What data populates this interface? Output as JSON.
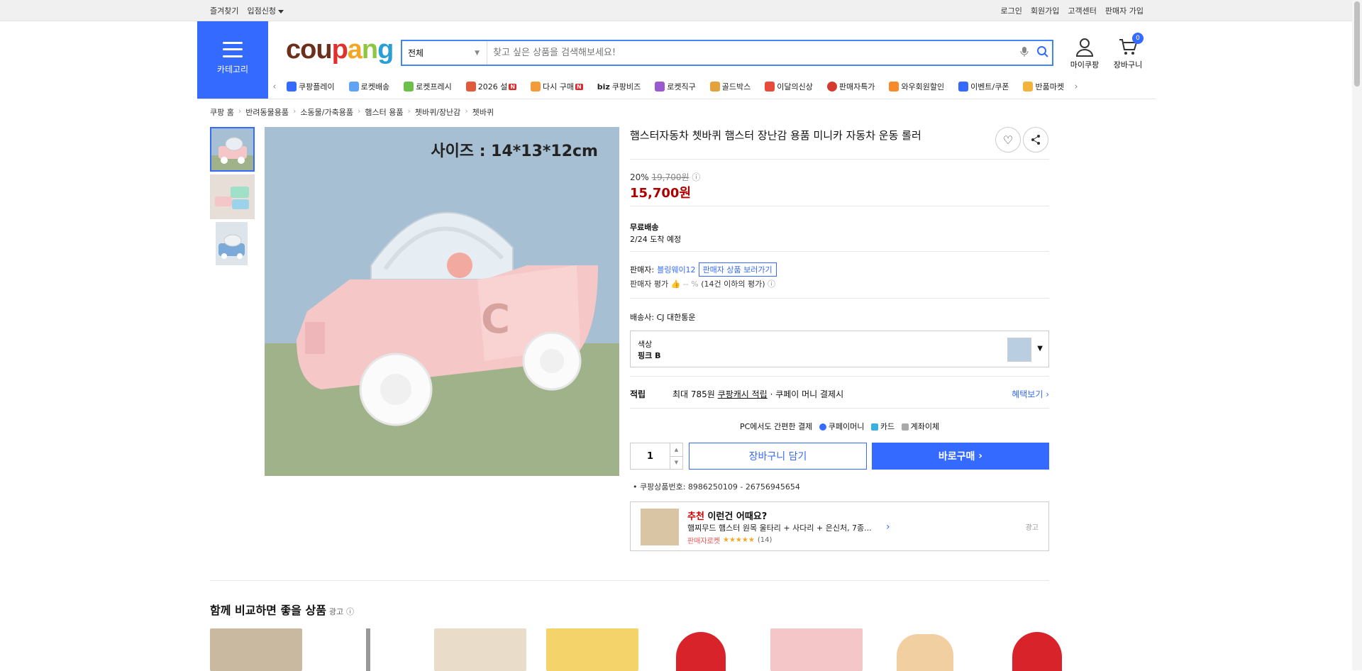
{
  "topbar": {
    "left": [
      "즐겨찾기",
      "입점신청"
    ],
    "right": [
      "로그인",
      "회원가입",
      "고객센터",
      "판매자 가입"
    ]
  },
  "header": {
    "category_label": "카테고리",
    "logo": {
      "c1": "cou",
      "c2": "p",
      "c3": "a",
      "c4": "n",
      "c5": "g"
    },
    "search_select": "전체",
    "search_placeholder": "찾고 싶은 상품을 검색해보세요!",
    "my_label": "마이쿠팡",
    "cart_label": "장바구니",
    "cart_count": "0"
  },
  "nav_items": [
    {
      "label": "쿠팡플레이",
      "color": "#346aff",
      "badge": ""
    },
    {
      "label": "로켓배송",
      "color": "#5fa3f5",
      "badge": ""
    },
    {
      "label": "로켓프레시",
      "color": "#6cc04a",
      "badge": ""
    },
    {
      "label": "2026 설",
      "color": "#e05a3b",
      "badge": "N"
    },
    {
      "label": "다시 구매",
      "color": "#f29b38",
      "badge": "N"
    },
    {
      "label": "쿠팡비즈",
      "color": "#333333",
      "badge": "",
      "prefix": "biz"
    },
    {
      "label": "로켓직구",
      "color": "#9b59d0",
      "badge": ""
    },
    {
      "label": "골드박스",
      "color": "#e3a23a",
      "badge": ""
    },
    {
      "label": "이달의신상",
      "color": "#e84b3c",
      "badge": ""
    },
    {
      "label": "판매자특가",
      "color": "#d63a2f",
      "badge": ""
    },
    {
      "label": "와우회원할인",
      "color": "#f58b2a",
      "badge": ""
    },
    {
      "label": "이벤트/쿠폰",
      "color": "#346aff",
      "badge": ""
    },
    {
      "label": "반품마켓",
      "color": "#f2b33d",
      "badge": ""
    }
  ],
  "breadcrumb": [
    "쿠팡 홈",
    "반려동물용품",
    "소동물/가축용품",
    "햄스터 용품",
    "쳇바퀴/장난감",
    "쳇바퀴"
  ],
  "product": {
    "size_text": "사이즈 : 14*13*12cm",
    "title": "햄스터자동차 쳇바퀴 햄스터 장난감 용품 미니카 자동차 운동 롤러",
    "discount": "20%",
    "original_price": "19,700원",
    "price": "15,700원",
    "shipping_title": "무료배송",
    "arrival": "2/24 도착 예정",
    "seller_label": "판매자:",
    "seller_name": "블링웨이12",
    "seller_button": "판매자 상품 보러가기",
    "rating_label": "판매자 평가",
    "rating_value": "-- %",
    "rating_note": "(14건 이하의 평가)",
    "courier_label": "배송사:",
    "courier": "CJ 대한통운",
    "option_label": "색상",
    "option_value": "핑크 B",
    "reward_label": "적립",
    "reward_text": "최대 785원",
    "reward_link": "쿠팡캐시 적립",
    "reward_suffix": "· 쿠페이 머니 결제시",
    "reward_more": "혜택보기",
    "pay_title": "PC에서도 간편한 결제",
    "pay_methods": [
      "쿠페이머니",
      "카드",
      "계좌이체"
    ],
    "quantity": "1",
    "cart_button": "장바구니 담기",
    "buy_button": "바로구매",
    "product_number": "쿠팡상품번호: 8986250109 - 26756945654"
  },
  "recommend": {
    "title_red": "추천",
    "title_rest": "이런건 어때요?",
    "name": "햄찌무드 햄스터 원목 울타리 + 사다리 + 은신처, 7종...",
    "seller_tag": "판매자로켓",
    "stars": "★★★★★",
    "count": "(14)",
    "ad": "광고"
  },
  "compare": {
    "title": "함께 비교하면 좋을 상품",
    "ad": "광고"
  },
  "colors": {
    "accent": "#346aff",
    "price_red": "#ae0000"
  }
}
